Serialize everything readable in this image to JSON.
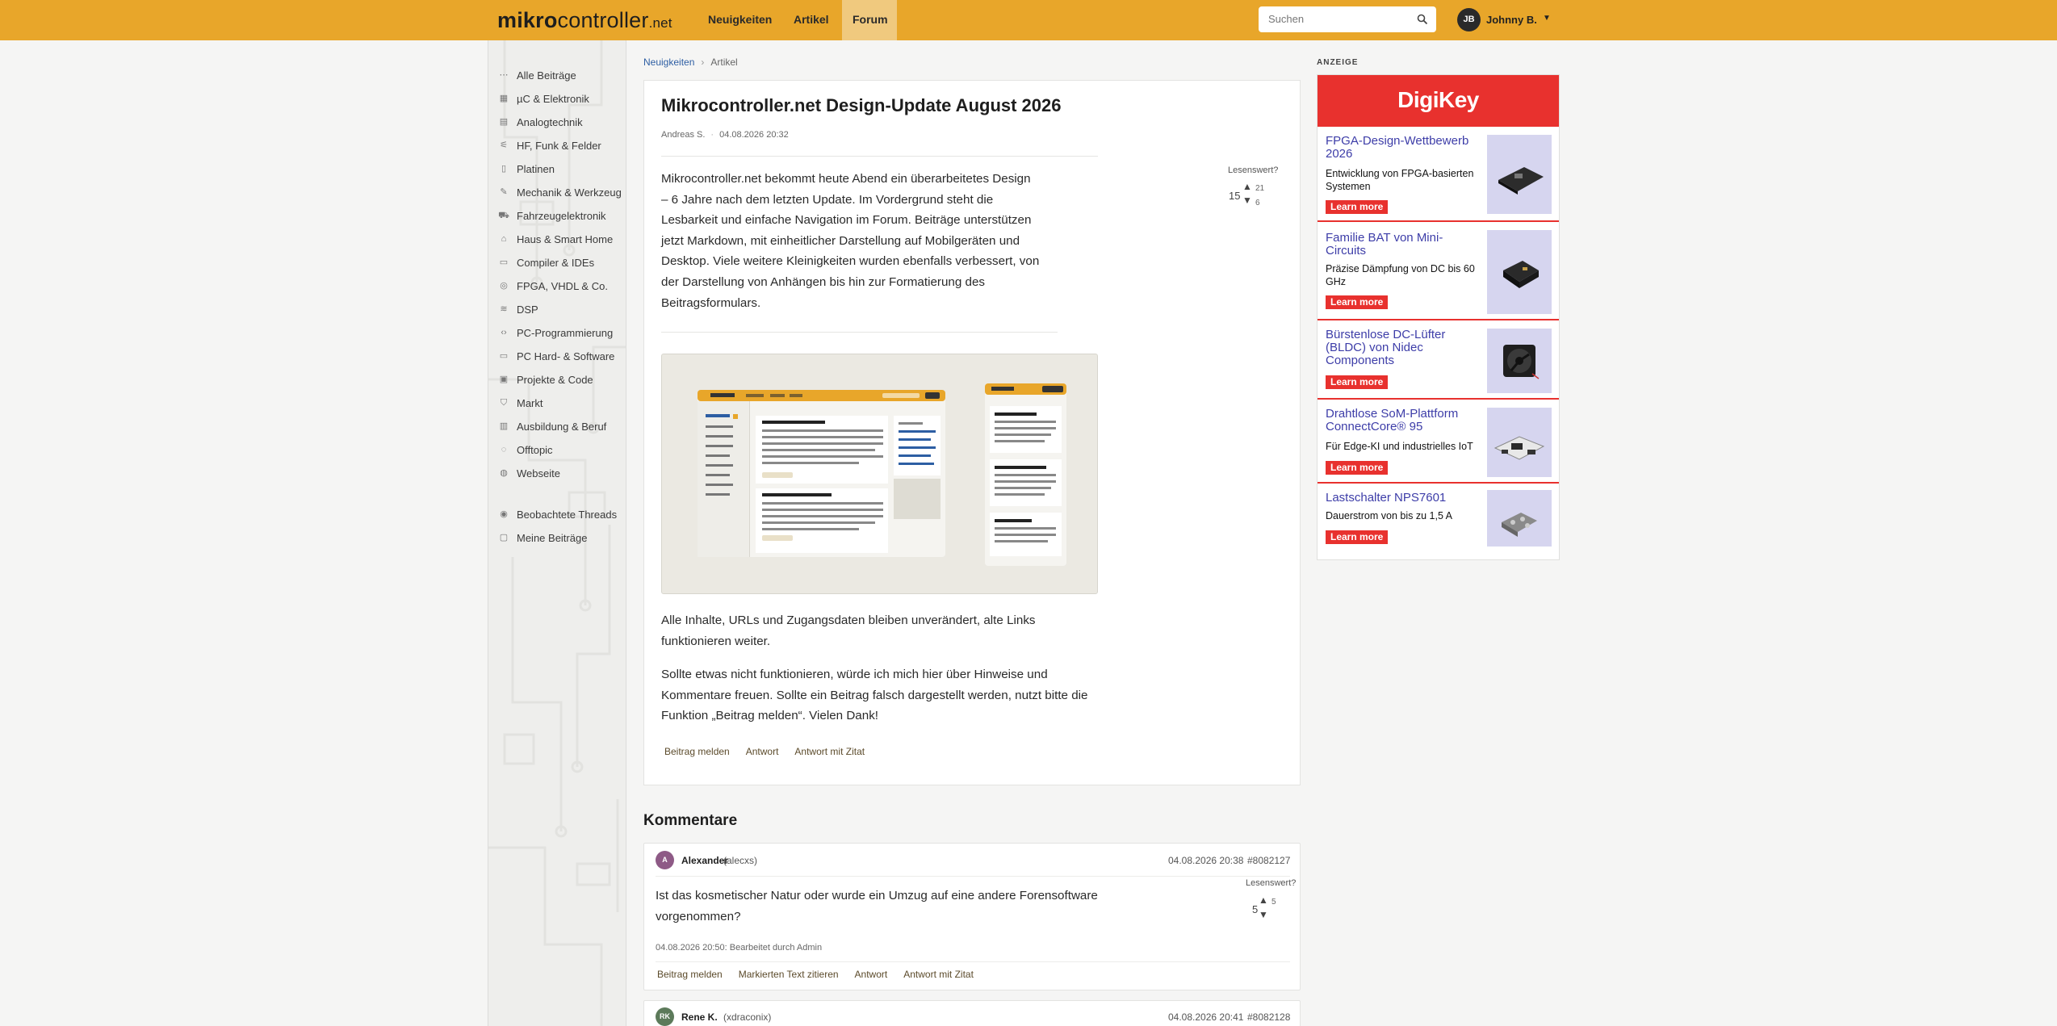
{
  "header": {
    "logo_bold": "mikro",
    "logo_thin": "controller",
    "logo_net": ".net",
    "nav": [
      {
        "label": "Neuigkeiten",
        "active": false
      },
      {
        "label": "Artikel",
        "active": false
      },
      {
        "label": "Forum",
        "active": true
      }
    ],
    "search_placeholder": "Suchen",
    "user_initials": "JB",
    "user_name": "Johnny B."
  },
  "sidebar": {
    "items": [
      {
        "label": "Alle Beiträge",
        "icon": "dots-icon"
      },
      {
        "label": "µC & Elektronik",
        "icon": "chip-icon"
      },
      {
        "label": "Analogtechnik",
        "icon": "analog-icon"
      },
      {
        "label": "HF, Funk & Felder",
        "icon": "antenna-icon"
      },
      {
        "label": "Platinen",
        "icon": "board-icon"
      },
      {
        "label": "Mechanik & Werkzeug",
        "icon": "wrench-icon"
      },
      {
        "label": "Fahrzeugelektronik",
        "icon": "car-icon"
      },
      {
        "label": "Haus & Smart Home",
        "icon": "home-icon"
      },
      {
        "label": "Compiler & IDEs",
        "icon": "monitor-icon"
      },
      {
        "label": "FPGA, VHDL & Co.",
        "icon": "fpga-icon"
      },
      {
        "label": "DSP",
        "icon": "dsp-icon"
      },
      {
        "label": "PC-Programmierung",
        "icon": "code-icon"
      },
      {
        "label": "PC Hard- & Software",
        "icon": "pc-icon"
      },
      {
        "label": "Projekte & Code",
        "icon": "project-icon"
      },
      {
        "label": "Markt",
        "icon": "cart-icon"
      },
      {
        "label": "Ausbildung & Beruf",
        "icon": "book-icon"
      },
      {
        "label": "Offtopic",
        "icon": "chat-icon"
      },
      {
        "label": "Webseite",
        "icon": "globe-icon"
      }
    ],
    "extra": [
      {
        "label": "Beobachtete Threads",
        "icon": "eye-icon"
      },
      {
        "label": "Meine Beiträge",
        "icon": "comment-icon"
      }
    ]
  },
  "breadcrumb": {
    "link": "Neuigkeiten",
    "current": "Artikel"
  },
  "article": {
    "title": "Mikrocontroller.net Design-Update August 2026",
    "author": "Andreas S.",
    "date": "04.08.2026 20:32",
    "lesenswert_label": "Lesenswert?",
    "score": "15",
    "up": "21",
    "down": "6",
    "paragraph1_lines": [
      "Mikrocontroller.net bekommt heute Abend ein überarbeitetes Design",
      "– 6 Jahre nach dem letzten Update. Im Vordergrund steht die",
      "Lesbarkeit und einfache Navigation im Forum. Beiträge unterstützen",
      "jetzt Markdown, mit einheitlicher Darstellung auf Mobilgeräten und",
      "Desktop. Viele weitere Kleinigkeiten wurden ebenfalls verbessert, von",
      "der Darstellung von Anhängen bis hin zur Formatierung des",
      "Beitragsformulars."
    ],
    "paragraph2_lines": [
      "Alle Inhalte, URLs und Zugangsdaten bleiben unverändert, alte Links",
      "funktionieren weiter."
    ],
    "paragraph3_lines": [
      "Sollte etwas nicht funktionieren, würde ich mich hier über Hinweise und",
      "Kommentare freuen. Sollte ein Beitrag falsch dargestellt werden, nutzt bitte die",
      "Funktion „Beitrag melden“. Vielen Dank!"
    ],
    "actions": [
      "Beitrag melden",
      "Antwort",
      "Antwort mit Zitat"
    ]
  },
  "comments_title": "Kommentare",
  "comments": [
    {
      "initials": "A",
      "name": "Alexander",
      "handle": "(alecxs)",
      "date": "04.08.2026 20:38",
      "id": "#8082127",
      "text_lines": [
        "Ist das kosmetischer Natur oder wurde ein Umzug auf eine andere Forensoftware",
        "vorgenommen?"
      ],
      "edited": "04.08.2026 20:50: Bearbeitet durch Admin",
      "lesenswert_label": "Lesenswert?",
      "score": "5",
      "up": "5",
      "actions": [
        "Beitrag melden",
        "Markierten Text zitieren",
        "Antwort",
        "Antwort mit Zitat"
      ]
    },
    {
      "initials": "RK",
      "name": "Rene K.",
      "handle": "(xdraconix)",
      "date": "04.08.2026 20:41",
      "id": "#8082128"
    }
  ],
  "ad": {
    "label": "ANZEIGE",
    "brand": "DigiKey",
    "items": [
      {
        "title_lines": [
          "FPGA-Design-Wettbewerb",
          "2026"
        ],
        "desc_lines": [
          "Entwicklung von FPGA-basierten",
          "Systemen"
        ],
        "button": "Learn more"
      },
      {
        "title_lines": [
          "Familie BAT von Mini-",
          "Circuits"
        ],
        "desc_lines": [
          "Präzise Dämpfung von DC bis 60",
          "GHz"
        ],
        "button": "Learn more"
      },
      {
        "title_lines": [
          "Bürstenlose DC-Lüfter",
          "(BLDC) von Nidec",
          "Components"
        ],
        "desc_lines": [],
        "button": "Learn more"
      },
      {
        "title_lines": [
          "Drahtlose SoM-Plattform",
          "ConnectCore® 95"
        ],
        "desc_lines": [
          "Für Edge-KI und industrielles IoT"
        ],
        "button": "Learn more"
      },
      {
        "title_lines": [
          "Lastschalter NPS7601"
        ],
        "desc_lines": [
          "Dauerstrom von bis zu 1,5 A"
        ],
        "button": "Learn more"
      }
    ]
  },
  "colors": {
    "brand": "#e8a62a",
    "ad_red": "#e8312e",
    "link": "#2d5ea3"
  }
}
